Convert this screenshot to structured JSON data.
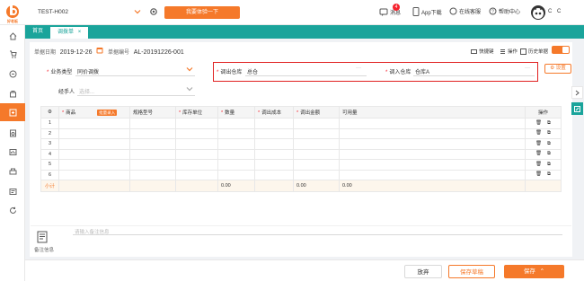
{
  "app": {
    "logo_text": "好老板",
    "store_name": "TEST-H002",
    "try_label": "我要体验一下",
    "accent": "#f5792a",
    "teal": "#1aa49b"
  },
  "topbar": {
    "message": "消息",
    "message_count": "4",
    "app_download": "App下载",
    "service": "在线客服",
    "help": "帮助中心",
    "user": "C C"
  },
  "sidebar": {
    "icons": [
      "home-icon",
      "cart-icon",
      "purchase-icon",
      "bag-icon",
      "inventory-icon",
      "finance-icon",
      "report-icon",
      "print-icon",
      "settings-icon",
      "refresh-icon"
    ]
  },
  "tabs": [
    {
      "label": "首页"
    },
    {
      "label": "调拨单"
    }
  ],
  "doc": {
    "date_label": "单据日期",
    "date_value": "2019-12-26",
    "number_label": "单据编号",
    "number_value": "AL-20191226-001",
    "shortcut": "快捷键",
    "operate": "操作",
    "history": "历史单据"
  },
  "form": {
    "biz_type_label": "业务类型",
    "biz_type_value": "同价调拨",
    "out_wh_label": "调出仓库",
    "out_wh_value": "总仓",
    "in_wh_label": "调入仓库",
    "in_wh_value": "仓库A",
    "settings": "设置",
    "handler_label": "经手人",
    "handler_placeholder": "选择..."
  },
  "table": {
    "columns": [
      "商品",
      "规格型号",
      "库存单位",
      "数量",
      "调出成本",
      "调出金额",
      "可用量",
      "操作"
    ],
    "batch_label": "批量录入",
    "rows": [
      "1",
      "2",
      "3",
      "4",
      "5",
      "6"
    ],
    "summary": {
      "label": "小计",
      "qty": "0.00",
      "cost": "0.00",
      "amount": "0.00"
    }
  },
  "remark": {
    "label": "备注信息",
    "placeholder": "请输入备注信息"
  },
  "actions": {
    "cancel": "放弃",
    "save_draft": "保存草稿",
    "save": "保存"
  }
}
